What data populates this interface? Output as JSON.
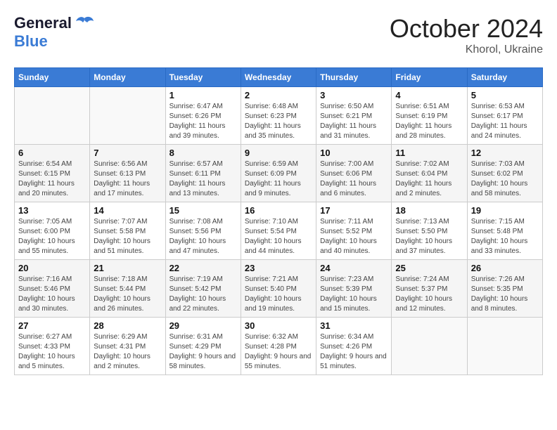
{
  "logo": {
    "line1": "General",
    "line2": "Blue"
  },
  "title": "October 2024",
  "subtitle": "Khorol, Ukraine",
  "days_header": [
    "Sunday",
    "Monday",
    "Tuesday",
    "Wednesday",
    "Thursday",
    "Friday",
    "Saturday"
  ],
  "weeks": [
    [
      {
        "num": "",
        "sunrise": "",
        "sunset": "",
        "daylight": ""
      },
      {
        "num": "",
        "sunrise": "",
        "sunset": "",
        "daylight": ""
      },
      {
        "num": "1",
        "sunrise": "Sunrise: 6:47 AM",
        "sunset": "Sunset: 6:26 PM",
        "daylight": "Daylight: 11 hours and 39 minutes."
      },
      {
        "num": "2",
        "sunrise": "Sunrise: 6:48 AM",
        "sunset": "Sunset: 6:23 PM",
        "daylight": "Daylight: 11 hours and 35 minutes."
      },
      {
        "num": "3",
        "sunrise": "Sunrise: 6:50 AM",
        "sunset": "Sunset: 6:21 PM",
        "daylight": "Daylight: 11 hours and 31 minutes."
      },
      {
        "num": "4",
        "sunrise": "Sunrise: 6:51 AM",
        "sunset": "Sunset: 6:19 PM",
        "daylight": "Daylight: 11 hours and 28 minutes."
      },
      {
        "num": "5",
        "sunrise": "Sunrise: 6:53 AM",
        "sunset": "Sunset: 6:17 PM",
        "daylight": "Daylight: 11 hours and 24 minutes."
      }
    ],
    [
      {
        "num": "6",
        "sunrise": "Sunrise: 6:54 AM",
        "sunset": "Sunset: 6:15 PM",
        "daylight": "Daylight: 11 hours and 20 minutes."
      },
      {
        "num": "7",
        "sunrise": "Sunrise: 6:56 AM",
        "sunset": "Sunset: 6:13 PM",
        "daylight": "Daylight: 11 hours and 17 minutes."
      },
      {
        "num": "8",
        "sunrise": "Sunrise: 6:57 AM",
        "sunset": "Sunset: 6:11 PM",
        "daylight": "Daylight: 11 hours and 13 minutes."
      },
      {
        "num": "9",
        "sunrise": "Sunrise: 6:59 AM",
        "sunset": "Sunset: 6:09 PM",
        "daylight": "Daylight: 11 hours and 9 minutes."
      },
      {
        "num": "10",
        "sunrise": "Sunrise: 7:00 AM",
        "sunset": "Sunset: 6:06 PM",
        "daylight": "Daylight: 11 hours and 6 minutes."
      },
      {
        "num": "11",
        "sunrise": "Sunrise: 7:02 AM",
        "sunset": "Sunset: 6:04 PM",
        "daylight": "Daylight: 11 hours and 2 minutes."
      },
      {
        "num": "12",
        "sunrise": "Sunrise: 7:03 AM",
        "sunset": "Sunset: 6:02 PM",
        "daylight": "Daylight: 10 hours and 58 minutes."
      }
    ],
    [
      {
        "num": "13",
        "sunrise": "Sunrise: 7:05 AM",
        "sunset": "Sunset: 6:00 PM",
        "daylight": "Daylight: 10 hours and 55 minutes."
      },
      {
        "num": "14",
        "sunrise": "Sunrise: 7:07 AM",
        "sunset": "Sunset: 5:58 PM",
        "daylight": "Daylight: 10 hours and 51 minutes."
      },
      {
        "num": "15",
        "sunrise": "Sunrise: 7:08 AM",
        "sunset": "Sunset: 5:56 PM",
        "daylight": "Daylight: 10 hours and 47 minutes."
      },
      {
        "num": "16",
        "sunrise": "Sunrise: 7:10 AM",
        "sunset": "Sunset: 5:54 PM",
        "daylight": "Daylight: 10 hours and 44 minutes."
      },
      {
        "num": "17",
        "sunrise": "Sunrise: 7:11 AM",
        "sunset": "Sunset: 5:52 PM",
        "daylight": "Daylight: 10 hours and 40 minutes."
      },
      {
        "num": "18",
        "sunrise": "Sunrise: 7:13 AM",
        "sunset": "Sunset: 5:50 PM",
        "daylight": "Daylight: 10 hours and 37 minutes."
      },
      {
        "num": "19",
        "sunrise": "Sunrise: 7:15 AM",
        "sunset": "Sunset: 5:48 PM",
        "daylight": "Daylight: 10 hours and 33 minutes."
      }
    ],
    [
      {
        "num": "20",
        "sunrise": "Sunrise: 7:16 AM",
        "sunset": "Sunset: 5:46 PM",
        "daylight": "Daylight: 10 hours and 30 minutes."
      },
      {
        "num": "21",
        "sunrise": "Sunrise: 7:18 AM",
        "sunset": "Sunset: 5:44 PM",
        "daylight": "Daylight: 10 hours and 26 minutes."
      },
      {
        "num": "22",
        "sunrise": "Sunrise: 7:19 AM",
        "sunset": "Sunset: 5:42 PM",
        "daylight": "Daylight: 10 hours and 22 minutes."
      },
      {
        "num": "23",
        "sunrise": "Sunrise: 7:21 AM",
        "sunset": "Sunset: 5:40 PM",
        "daylight": "Daylight: 10 hours and 19 minutes."
      },
      {
        "num": "24",
        "sunrise": "Sunrise: 7:23 AM",
        "sunset": "Sunset: 5:39 PM",
        "daylight": "Daylight: 10 hours and 15 minutes."
      },
      {
        "num": "25",
        "sunrise": "Sunrise: 7:24 AM",
        "sunset": "Sunset: 5:37 PM",
        "daylight": "Daylight: 10 hours and 12 minutes."
      },
      {
        "num": "26",
        "sunrise": "Sunrise: 7:26 AM",
        "sunset": "Sunset: 5:35 PM",
        "daylight": "Daylight: 10 hours and 8 minutes."
      }
    ],
    [
      {
        "num": "27",
        "sunrise": "Sunrise: 6:27 AM",
        "sunset": "Sunset: 4:33 PM",
        "daylight": "Daylight: 10 hours and 5 minutes."
      },
      {
        "num": "28",
        "sunrise": "Sunrise: 6:29 AM",
        "sunset": "Sunset: 4:31 PM",
        "daylight": "Daylight: 10 hours and 2 minutes."
      },
      {
        "num": "29",
        "sunrise": "Sunrise: 6:31 AM",
        "sunset": "Sunset: 4:29 PM",
        "daylight": "Daylight: 9 hours and 58 minutes."
      },
      {
        "num": "30",
        "sunrise": "Sunrise: 6:32 AM",
        "sunset": "Sunset: 4:28 PM",
        "daylight": "Daylight: 9 hours and 55 minutes."
      },
      {
        "num": "31",
        "sunrise": "Sunrise: 6:34 AM",
        "sunset": "Sunset: 4:26 PM",
        "daylight": "Daylight: 9 hours and 51 minutes."
      },
      {
        "num": "",
        "sunrise": "",
        "sunset": "",
        "daylight": ""
      },
      {
        "num": "",
        "sunrise": "",
        "sunset": "",
        "daylight": ""
      }
    ]
  ]
}
